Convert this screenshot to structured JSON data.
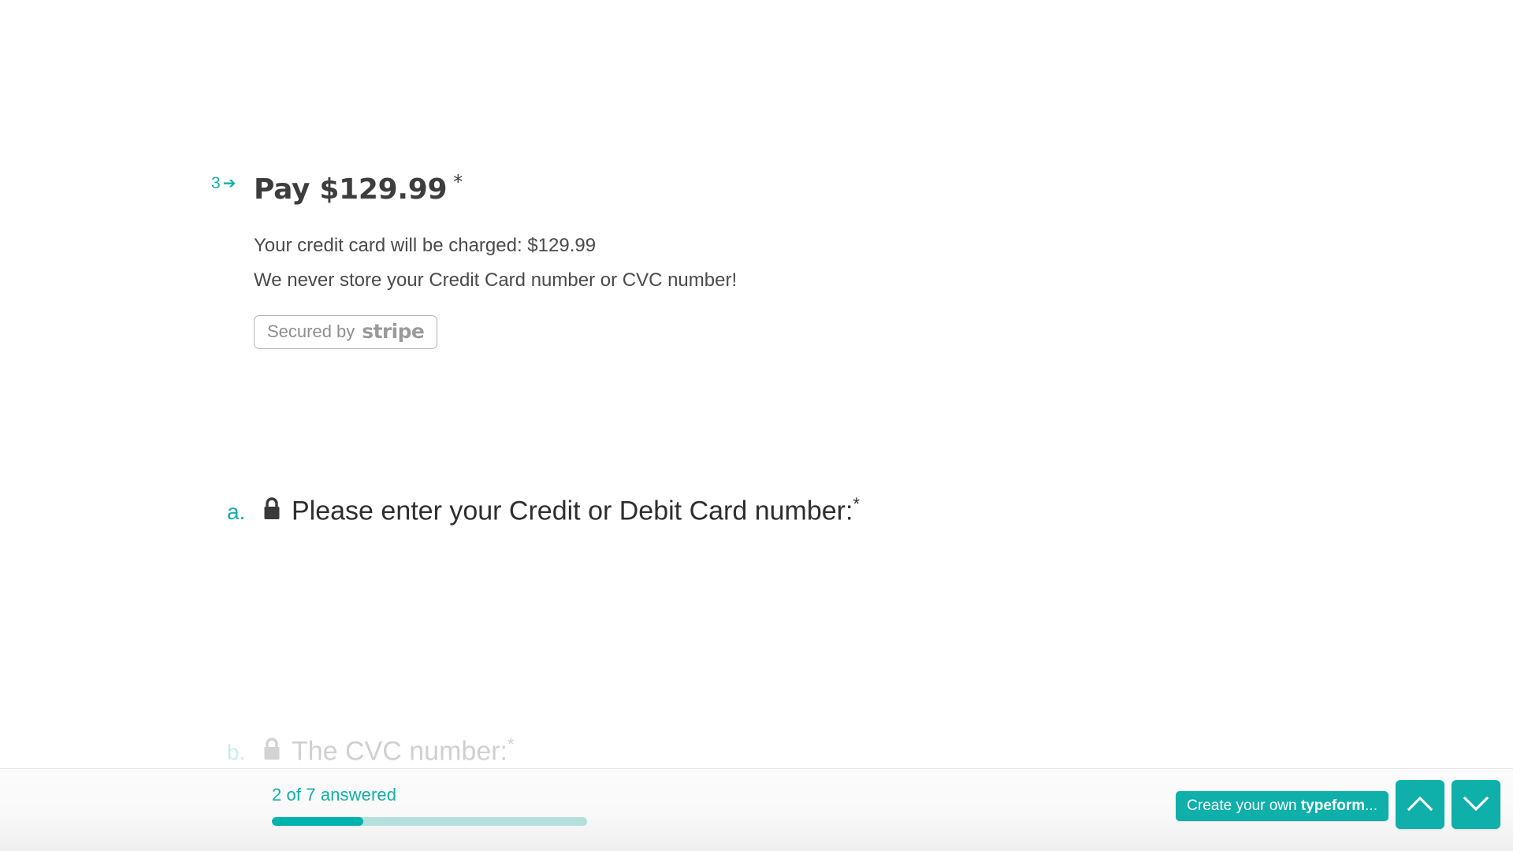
{
  "theme": {
    "accent": "#0FAFAA",
    "accent_text": "#13ADA8",
    "progress_track": "#B3DFDD",
    "progress_fill": "#00B2AC",
    "body_text": "#3D3D3D",
    "page_bg": "#FFFFFF"
  },
  "question": {
    "number": "3",
    "arrow": "➔",
    "title": "Pay $129.99",
    "required_mark": "*",
    "description_line1": "Your credit card will be charged: $129.99",
    "description_line2": "We never store your Credit Card number or CVC number!",
    "badge": {
      "prefix": "Secured by",
      "brand": "stripe"
    }
  },
  "subquestions": [
    {
      "marker": "a.",
      "icon": "lock-icon",
      "title": "Please enter your Credit or Debit Card number:",
      "required_mark": "*",
      "value": "",
      "placeholder": ""
    },
    {
      "marker": "b.",
      "icon": "lock-icon",
      "title": "The CVC number:",
      "required_mark": "*",
      "value": "",
      "placeholder": ""
    }
  ],
  "footer": {
    "progress_label": "2 of 7 answered",
    "progress_answered": 2,
    "progress_total": 7,
    "progress_percent": 29,
    "cta_prefix": "Create your own ",
    "cta_brand": "typeform",
    "cta_suffix": "...",
    "nav_up_icon": "chevron-up-icon",
    "nav_down_icon": "chevron-down-icon"
  }
}
